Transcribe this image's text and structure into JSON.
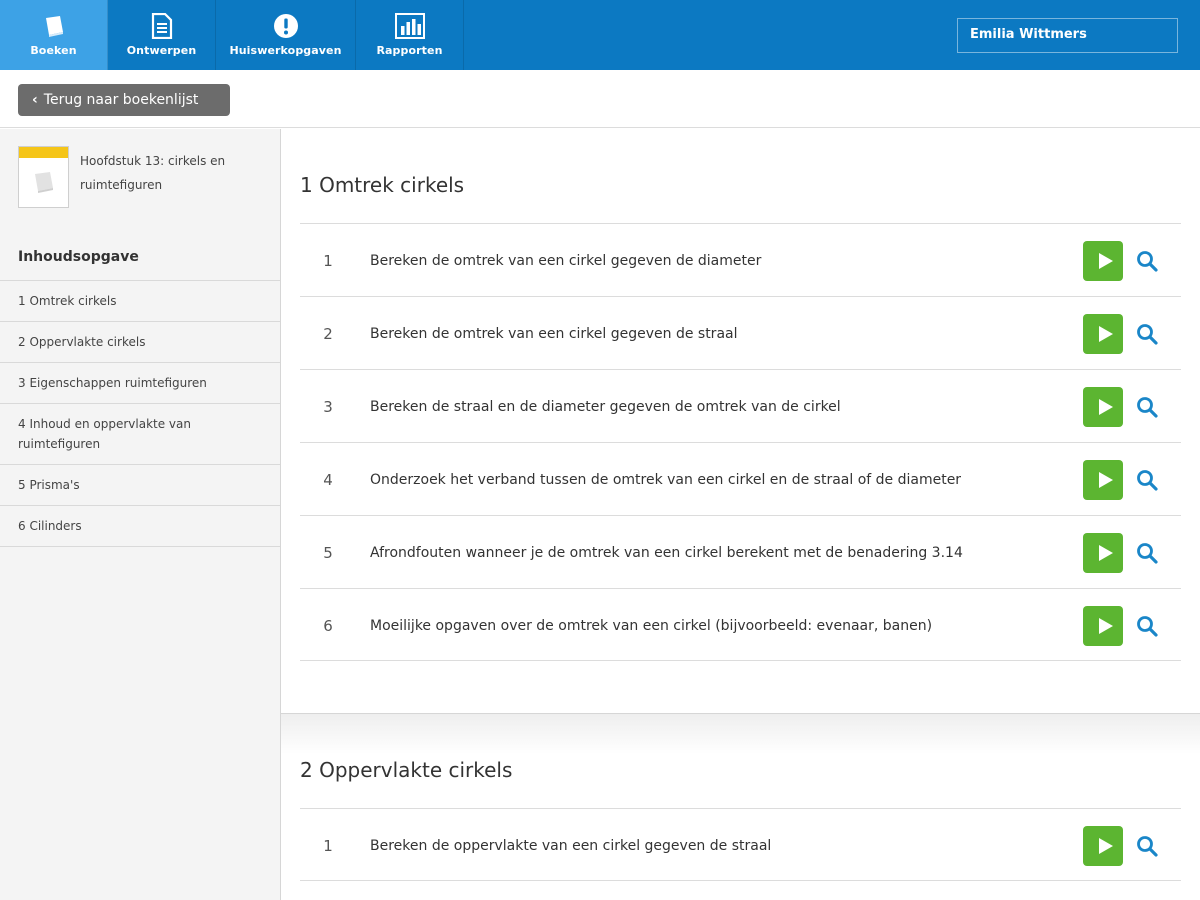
{
  "nav": {
    "tabs": [
      {
        "label": "Boeken",
        "icon": "book-icon"
      },
      {
        "label": "Ontwerpen",
        "icon": "document-icon"
      },
      {
        "label": "Huiswerkopgaven",
        "icon": "exclamation-icon"
      },
      {
        "label": "Rapporten",
        "icon": "bar-chart-icon"
      }
    ],
    "user_name": "Emilia Wittmers"
  },
  "toolbar": {
    "back_label": "Terug naar boekenlijst"
  },
  "sidebar": {
    "book_title": "Hoofdstuk 13: cirkels en ruimtefiguren",
    "toc_heading": "Inhoudsopgave",
    "items": [
      {
        "label": "1 Omtrek cirkels"
      },
      {
        "label": "2 Oppervlakte cirkels"
      },
      {
        "label": "3 Eigenschappen ruimtefiguren"
      },
      {
        "label": "4 Inhoud en oppervlakte van ruimtefiguren"
      },
      {
        "label": "5 Prisma's"
      },
      {
        "label": "6 Cilinders"
      }
    ]
  },
  "sections": [
    {
      "title": "1 Omtrek cirkels",
      "exercises": [
        {
          "number": "1",
          "text": "Bereken de omtrek van een cirkel gegeven de diameter"
        },
        {
          "number": "2",
          "text": "Bereken de omtrek van een cirkel gegeven de straal"
        },
        {
          "number": "3",
          "text": "Bereken de straal en de diameter gegeven de omtrek van de cirkel"
        },
        {
          "number": "4",
          "text": "Onderzoek het verband tussen de omtrek van een cirkel en de straal of de diameter"
        },
        {
          "number": "5",
          "text": "Afrondfouten wanneer je de omtrek van een cirkel berekent met de benadering 3.14"
        },
        {
          "number": "6",
          "text": "Moeilijke opgaven over de omtrek van een cirkel (bijvoorbeeld: evenaar, banen)"
        }
      ]
    },
    {
      "title": "2 Oppervlakte cirkels",
      "exercises": [
        {
          "number": "1",
          "text": "Bereken de oppervlakte van een cirkel gegeven de straal"
        }
      ]
    }
  ],
  "colors": {
    "nav_bg": "#0c79c2",
    "nav_active": "#3da2e6",
    "play_green": "#5cb531",
    "search_blue": "#1a86c8"
  }
}
